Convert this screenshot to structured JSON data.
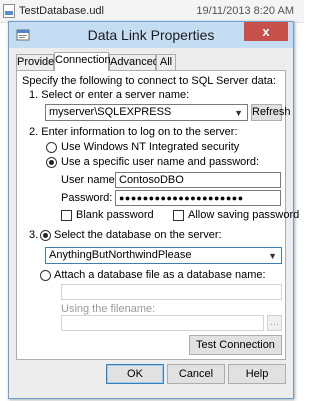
{
  "background": {
    "filename": "TestDatabase.udl",
    "datetime": "19/11/2013 8:20 AM"
  },
  "dialog": {
    "title": "Data Link Properties",
    "close_glyph": "x",
    "tabs": [
      "Provider",
      "Connection",
      "Advanced",
      "All"
    ],
    "active_tab": "Connection",
    "intro": "Specify the following to connect to SQL Server data:",
    "step1": {
      "label": "1. Select or enter a server name:",
      "server": "myserver\\SQLEXPRESS",
      "refresh": "Refresh"
    },
    "step2": {
      "label": "2. Enter information to log on to the server:",
      "opt_windows": "Use Windows NT Integrated security",
      "opt_specific": "Use a specific user name and password:",
      "selected": "specific",
      "username_label": "User name:",
      "username": "ContosoDBO",
      "password_label": "Password:",
      "password_mask": "●●●●●●●●●●●●●●●●●●●●●",
      "blank_password": "Blank password",
      "allow_saving": "Allow saving password"
    },
    "step3": {
      "number": "3.",
      "opt_select": "Select the database on the server:",
      "database": "AnythingButNorthwindPlease",
      "opt_attach": "Attach a database file as a database name:",
      "attach_value": "",
      "using_filename": "Using the filename:",
      "filename_value": "",
      "browse": "..."
    },
    "test_connection": "Test Connection",
    "buttons": {
      "ok": "OK",
      "cancel": "Cancel",
      "help": "Help"
    }
  }
}
